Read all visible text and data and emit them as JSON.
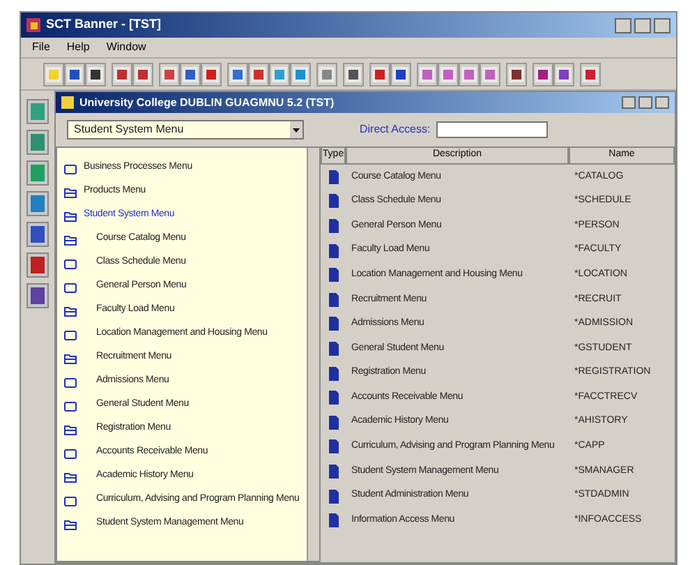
{
  "window": {
    "title": "SCT Banner - [TST]"
  },
  "menu": [
    {
      "label": "File",
      "disabled": false
    },
    {
      "label": "Help",
      "disabled": false
    },
    {
      "label": "Window",
      "disabled": false
    }
  ],
  "inner_window": {
    "title": "University College DUBLIN GUAGMNU 5.2 (TST)"
  },
  "menu_select": {
    "value": "Student System Menu"
  },
  "direct_access": {
    "label": "Direct Access:"
  },
  "tree": [
    {
      "label": "Business Processes Menu",
      "expanded": false,
      "selected": false
    },
    {
      "label": "Products Menu",
      "expanded": true,
      "selected": false
    },
    {
      "label": "Student System Menu",
      "expanded": true,
      "selected": true,
      "children": [
        {
          "label": "Course Catalog Menu",
          "expanded": true,
          "selected": false
        },
        {
          "label": "Class Schedule Menu",
          "expanded": false,
          "selected": false
        },
        {
          "label": "General Person Menu",
          "expanded": false,
          "selected": false
        },
        {
          "label": "Faculty Load Menu",
          "expanded": true,
          "selected": false
        },
        {
          "label": "Location Management and Housing Menu",
          "expanded": false,
          "selected": false
        },
        {
          "label": "Recruitment Menu",
          "expanded": true,
          "selected": false
        },
        {
          "label": "Admissions Menu",
          "expanded": false,
          "selected": false
        },
        {
          "label": "General Student Menu",
          "expanded": false,
          "selected": false
        },
        {
          "label": "Registration Menu",
          "expanded": true,
          "selected": false
        },
        {
          "label": "Accounts Receivable Menu",
          "expanded": false,
          "selected": false
        },
        {
          "label": "Academic History Menu",
          "expanded": true,
          "selected": false
        },
        {
          "label": "Curriculum, Advising and Program Planning Menu",
          "expanded": false,
          "selected": false
        },
        {
          "label": "Student System Management Menu",
          "expanded": true,
          "selected": false
        }
      ]
    }
  ],
  "table": {
    "columns": [
      "Type",
      "Description",
      "Name"
    ],
    "rows": [
      {
        "description": "Course Catalog Menu",
        "name": "*CATALOG"
      },
      {
        "description": "Class Schedule Menu",
        "name": "*SCHEDULE"
      },
      {
        "description": "General Person Menu",
        "name": "*PERSON"
      },
      {
        "description": "Faculty Load Menu",
        "name": "*FACULTY"
      },
      {
        "description": "Location Management and Housing Menu",
        "name": "*LOCATION"
      },
      {
        "description": "Recruitment Menu",
        "name": "*RECRUIT"
      },
      {
        "description": "Admissions Menu",
        "name": "*ADMISSION"
      },
      {
        "description": "General Student Menu",
        "name": "*GSTUDENT"
      },
      {
        "description": "Registration Menu",
        "name": "*REGISTRATION"
      },
      {
        "description": "Accounts Receivable Menu",
        "name": "*FACCTRECV"
      },
      {
        "description": "Academic History Menu",
        "name": "*AHISTORY"
      },
      {
        "description": "Curriculum, Advising and Program Planning Menu",
        "name": "*CAPP"
      },
      {
        "description": "Student System Management Menu",
        "name": "*SMANAGER"
      },
      {
        "description": "Student Administration Menu",
        "name": "*STDADMIN"
      },
      {
        "description": "Information Access Menu",
        "name": "*INFOACCESS"
      }
    ]
  }
}
